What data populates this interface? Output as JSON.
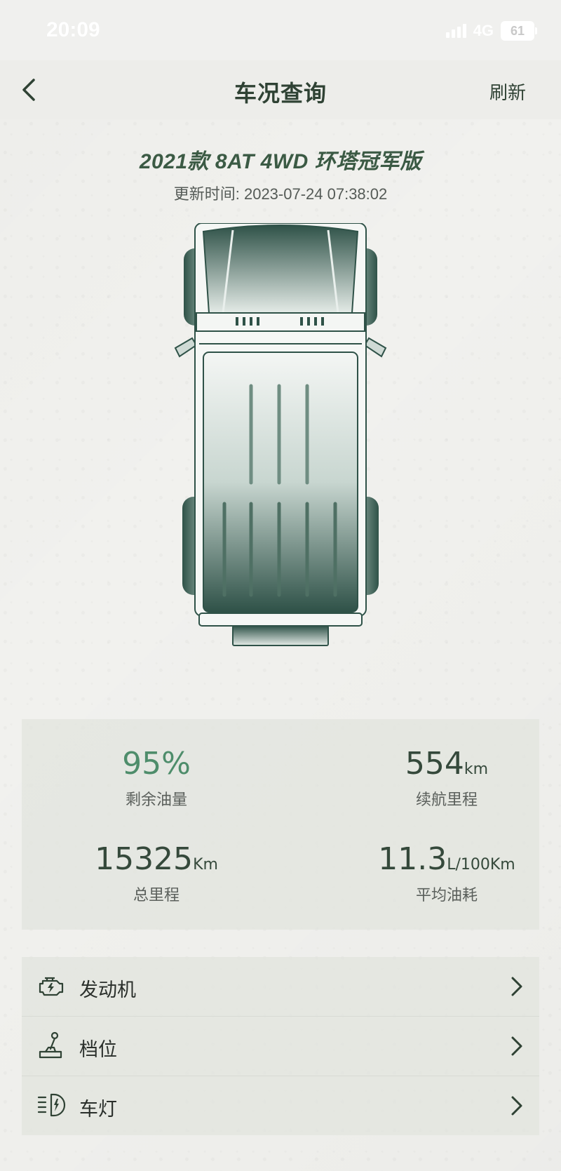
{
  "status_bar": {
    "time": "20:09",
    "network": "4G",
    "battery": "61"
  },
  "nav": {
    "title": "车况查询",
    "refresh_label": "刷新"
  },
  "vehicle": {
    "model": "2021款 8AT 4WD 环塔冠军版",
    "update_label": "更新时间: ",
    "update_time": "2023-07-24 07:38:02"
  },
  "stats": {
    "fuel": {
      "value": "95%",
      "unit": "",
      "label": "剩余油量"
    },
    "range": {
      "value": "554",
      "unit": "km",
      "label": "续航里程"
    },
    "odometer": {
      "value": "15325",
      "unit": "Km",
      "label": "总里程"
    },
    "consumption": {
      "value": "11.3",
      "unit": "L/100Km",
      "label": "平均油耗"
    }
  },
  "menu": [
    {
      "label": "发动机",
      "icon": "engine-icon"
    },
    {
      "label": "档位",
      "icon": "gear-shift-icon"
    },
    {
      "label": "车灯",
      "icon": "headlight-icon"
    }
  ],
  "colors": {
    "accent_green": "#4e8d6b",
    "text_dark": "#2f4234",
    "panel_bg": "#e2e4de"
  }
}
